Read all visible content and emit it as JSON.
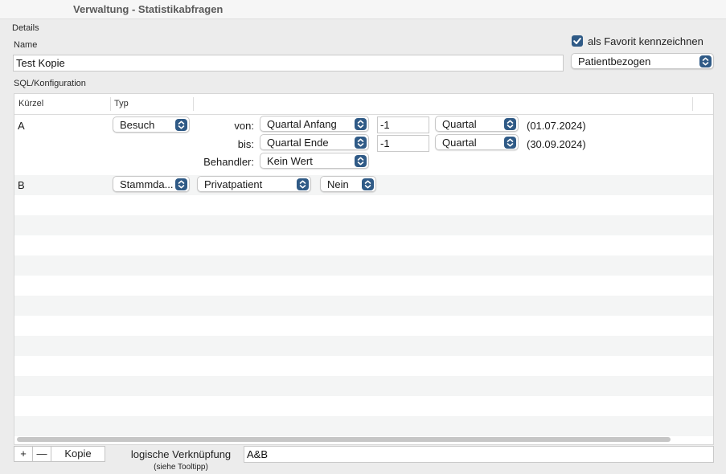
{
  "window": {
    "title": "Verwaltung - Statistikabfragen"
  },
  "details": {
    "section_label": "Details",
    "name_label": "Name",
    "name_value": "Test Kopie",
    "favorite_label": "als Favorit kennzeichnen",
    "favorite_checked": true,
    "scope_value": "Patientbezogen"
  },
  "sql": {
    "section_label": "SQL/Konfiguration",
    "columns": {
      "kuerzel": "Kürzel",
      "typ": "Typ"
    },
    "row_a": {
      "kuerzel": "A",
      "typ": "Besuch",
      "von_label": "von:",
      "von_select": "Quartal Anfang",
      "von_offset": "-1",
      "von_unit": "Quartal",
      "von_date": "(01.07.2024)",
      "bis_label": "bis:",
      "bis_select": "Quartal Ende",
      "bis_offset": "-1",
      "bis_unit": "Quartal",
      "bis_date": "(30.09.2024)",
      "behandler_label": "Behandler:",
      "behandler_select": "Kein Wert"
    },
    "row_b": {
      "kuerzel": "B",
      "typ": "Stammda...",
      "field": "Privatpatient",
      "value": "Nein"
    }
  },
  "footer": {
    "add_label": "+",
    "remove_label": "—",
    "copy_label": "Kopie",
    "logic_label": "logische Verknüpfung",
    "logic_hint": "(siehe Tooltipp)",
    "logic_value": "A&B"
  },
  "colors": {
    "accent": "#2f5a86"
  }
}
